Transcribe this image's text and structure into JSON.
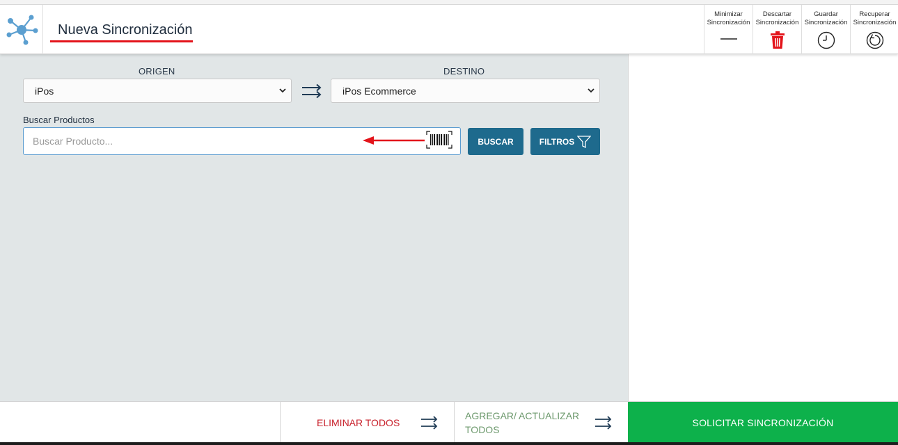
{
  "header": {
    "title": "Nueva Sincronización",
    "actions": [
      {
        "line1": "Minimizar",
        "line2": "Sincronización",
        "icon": "minimize-icon"
      },
      {
        "line1": "Descartar",
        "line2": "Sincronización",
        "icon": "trash-icon"
      },
      {
        "line1": "Guardar",
        "line2": "Sincronización",
        "icon": "clock-icon"
      },
      {
        "line1": "Recuperar",
        "line2": "Sincronización",
        "icon": "refresh-icon"
      }
    ]
  },
  "sync": {
    "origin_label": "ORIGEN",
    "origin_value": "iPos",
    "destination_label": "DESTINO",
    "destination_value": "iPos Ecommerce"
  },
  "search": {
    "label": "Buscar Productos",
    "placeholder": "Buscar Producto...",
    "search_button": "BUSCAR",
    "filter_button": "FILTROS"
  },
  "footer": {
    "remove_all": "ELIMINAR TODOS",
    "add_update_line1": "AGREGAR/ ACTUALIZAR",
    "add_update_line2": "TODOS",
    "request_sync": "SOLICITAR SINCRONIZACIÓN"
  },
  "colors": {
    "accent_blue": "#1e6a8d",
    "danger_red": "#e3141b",
    "success_green": "#0db14b",
    "panel_gray": "#e1e6e7"
  }
}
